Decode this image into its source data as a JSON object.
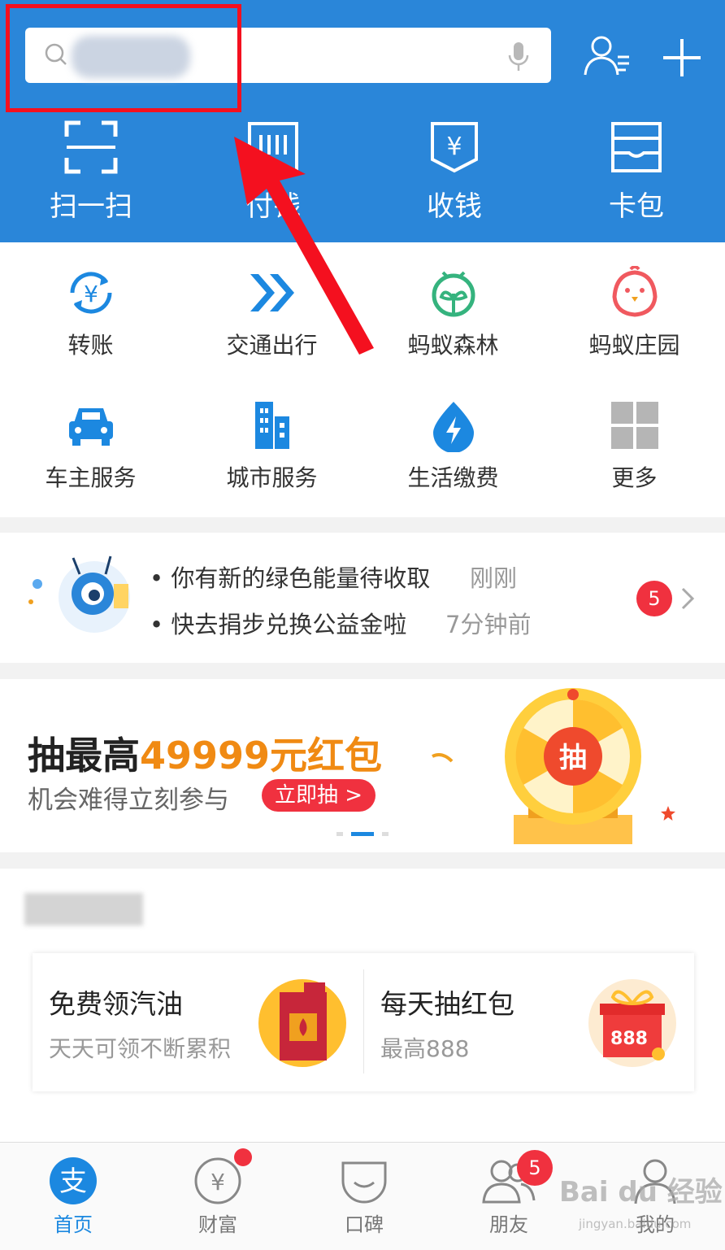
{
  "header": {
    "search_placeholder": "",
    "quick_actions": [
      {
        "label": "扫一扫",
        "icon": "scan-icon"
      },
      {
        "label": "付钱",
        "icon": "barcode-icon"
      },
      {
        "label": "收钱",
        "icon": "receive-money-icon"
      },
      {
        "label": "卡包",
        "icon": "card-wallet-icon"
      }
    ]
  },
  "grid": [
    {
      "label": "转账",
      "icon": "transfer-icon",
      "color": "#1c88e0"
    },
    {
      "label": "交通出行",
      "icon": "transport-icon",
      "color": "#1c88e0"
    },
    {
      "label": "蚂蚁森林",
      "icon": "ant-forest-icon",
      "color": "#35b37e"
    },
    {
      "label": "蚂蚁庄园",
      "icon": "ant-farm-icon",
      "color": "#f0595f"
    },
    {
      "label": "车主服务",
      "icon": "car-icon",
      "color": "#1c88e0"
    },
    {
      "label": "城市服务",
      "icon": "city-icon",
      "color": "#1c88e0"
    },
    {
      "label": "生活缴费",
      "icon": "utility-icon",
      "color": "#1c88e0"
    },
    {
      "label": "更多",
      "icon": "more-grid-icon",
      "color": "#b5b5b5"
    }
  ],
  "notices": [
    {
      "text": "你有新的绿色能量待收取",
      "time": "刚刚"
    },
    {
      "text": "快去捐步兑换公益金啦",
      "time": "7分钟前"
    }
  ],
  "notice_badge": "5",
  "banner": {
    "title_prefix": "抽最高",
    "title_highlight": "49999元红包",
    "subtitle": "机会难得立刻参与",
    "button": "立即抽 >",
    "wheel_char": "抽"
  },
  "recommend": [
    {
      "title": "免费领汽油",
      "subtitle": "天天可领不断累积"
    },
    {
      "title": "每天抽红包",
      "subtitle": "最高888",
      "gift_text": "888"
    }
  ],
  "tabs": [
    {
      "label": "首页",
      "icon": "home-alipay-icon",
      "active": true
    },
    {
      "label": "财富",
      "icon": "wealth-icon"
    },
    {
      "label": "口碑",
      "icon": "koubei-icon"
    },
    {
      "label": "朋友",
      "icon": "friends-icon",
      "badge": "5"
    },
    {
      "label": "我的",
      "icon": "profile-icon"
    }
  ],
  "watermark": {
    "main": "Bai du 经验",
    "sub": "jingyan.baidu.com"
  },
  "colors": {
    "primary": "#2a86d9",
    "accent": "#f08a13",
    "alert": "#f0313f",
    "annotation": "#f4101f"
  }
}
